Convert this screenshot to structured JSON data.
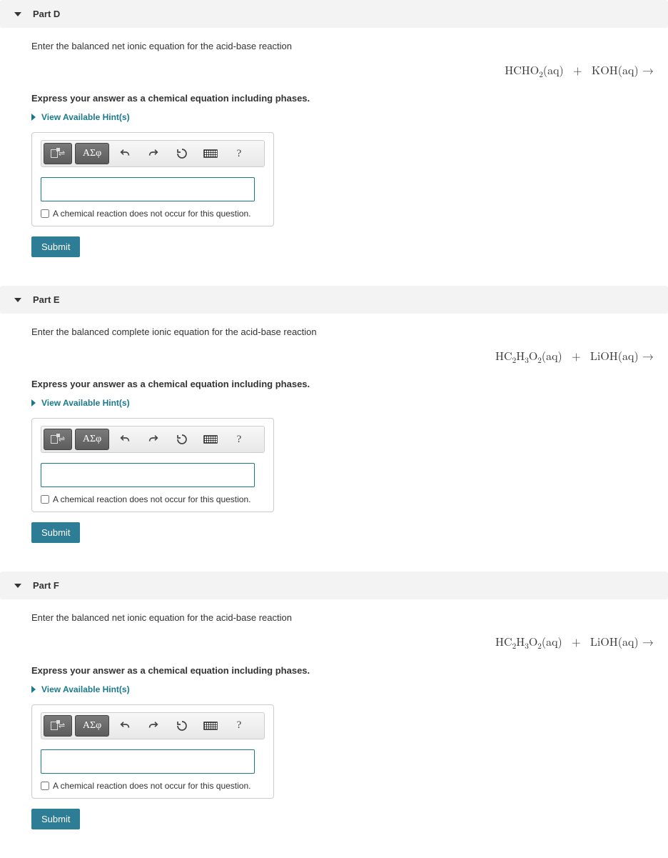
{
  "common": {
    "instruction": "Express your answer as a chemical equation including phases.",
    "hints_label": "View Available Hint(s)",
    "checkbox_label": "A chemical reaction does not occur for this question.",
    "submit_label": "Submit",
    "toolbar": {
      "greek_label": "ΑΣφ",
      "help_label": "?"
    }
  },
  "parts": [
    {
      "id": "D",
      "title": "Part D",
      "question": "Enter the balanced net ionic equation for the acid-base reaction",
      "equation_html": "HCHO<sub>2</sub>(aq) &nbsp;+&nbsp; KOH(aq) →"
    },
    {
      "id": "E",
      "title": "Part E",
      "question": "Enter the balanced complete ionic equation for the acid-base reaction",
      "equation_html": "HC<sub>2</sub>H<sub>3</sub>O<sub>2</sub>(aq) &nbsp;+&nbsp; LiOH(aq) →"
    },
    {
      "id": "F",
      "title": "Part F",
      "question": "Enter the balanced net ionic equation for the acid-base reaction",
      "equation_html": "HC<sub>2</sub>H<sub>3</sub>O<sub>2</sub>(aq) &nbsp;+&nbsp; LiOH(aq) →"
    }
  ]
}
